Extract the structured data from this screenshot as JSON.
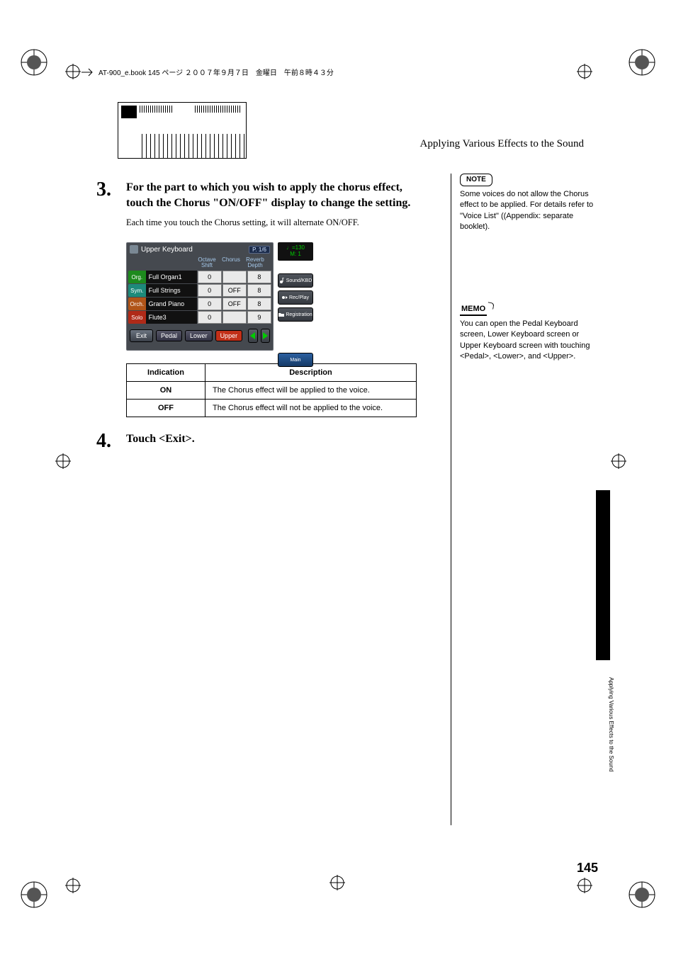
{
  "runhead": "AT-900_e.book  145 ページ  ２００７年９月７日　金曜日　午前８時４３分",
  "section_title": "Applying Various Effects to the Sound",
  "side_tab_label": "Applying Various Effects to the Sound",
  "page_number": "145",
  "step3": {
    "num": "3.",
    "head": "For the part to which you wish to apply the chorus effect, touch the Chorus \"ON/OFF\" display to change the setting.",
    "para": "Each time you touch the Chorus setting, it will alternate ON/OFF."
  },
  "ui": {
    "title": "Upper Keyboard",
    "page_badge": "P. 1/6",
    "headers": {
      "octave": "Octave\nShift",
      "chorus": "Chorus",
      "reverb": "Reverb\nDepth"
    },
    "rows": [
      {
        "tag": "Org.",
        "tag_class": "tag-org",
        "name": "Full Organ1",
        "octave": "0",
        "chorus": "",
        "reverb": "8"
      },
      {
        "tag": "Sym.",
        "tag_class": "tag-sym",
        "name": "Full Strings",
        "octave": "0",
        "chorus": "OFF",
        "reverb": "8"
      },
      {
        "tag": "Orch.",
        "tag_class": "tag-orch",
        "name": "Grand Piano",
        "octave": "0",
        "chorus": "OFF",
        "reverb": "8"
      },
      {
        "tag": "Solo",
        "tag_class": "tag-solo",
        "name": "Flute3",
        "octave": "0",
        "chorus": "",
        "reverb": "9"
      }
    ],
    "buttons": {
      "exit": "Exit",
      "pedal": "Pedal",
      "lower": "Lower",
      "upper": "Upper"
    },
    "tempo": {
      "bpm": "♩=130",
      "meas": "M:     1"
    },
    "side_buttons": {
      "sound": "Sound/KBD",
      "rec": "Rec/Play",
      "reg": "Registration",
      "main": "Main"
    }
  },
  "table": {
    "head_ind": "Indication",
    "head_desc": "Description",
    "rows": [
      {
        "ind": "ON",
        "desc": "The Chorus effect will be applied to the voice."
      },
      {
        "ind": "OFF",
        "desc": "The Chorus effect will not be applied to the voice."
      }
    ]
  },
  "step4": {
    "num": "4.",
    "head": "Touch <Exit>."
  },
  "notes": {
    "note_label": "NOTE",
    "note_text": "Some voices do not allow the Chorus effect to be applied. For details refer to \"Voice List\" ((Appendix: separate booklet).",
    "memo_label": "MEMO",
    "memo_text": "You can open the Pedal Keyboard screen, Lower Keyboard screen or Upper Keyboard screen with touching <Pedal>, <Lower>, and <Upper>."
  }
}
